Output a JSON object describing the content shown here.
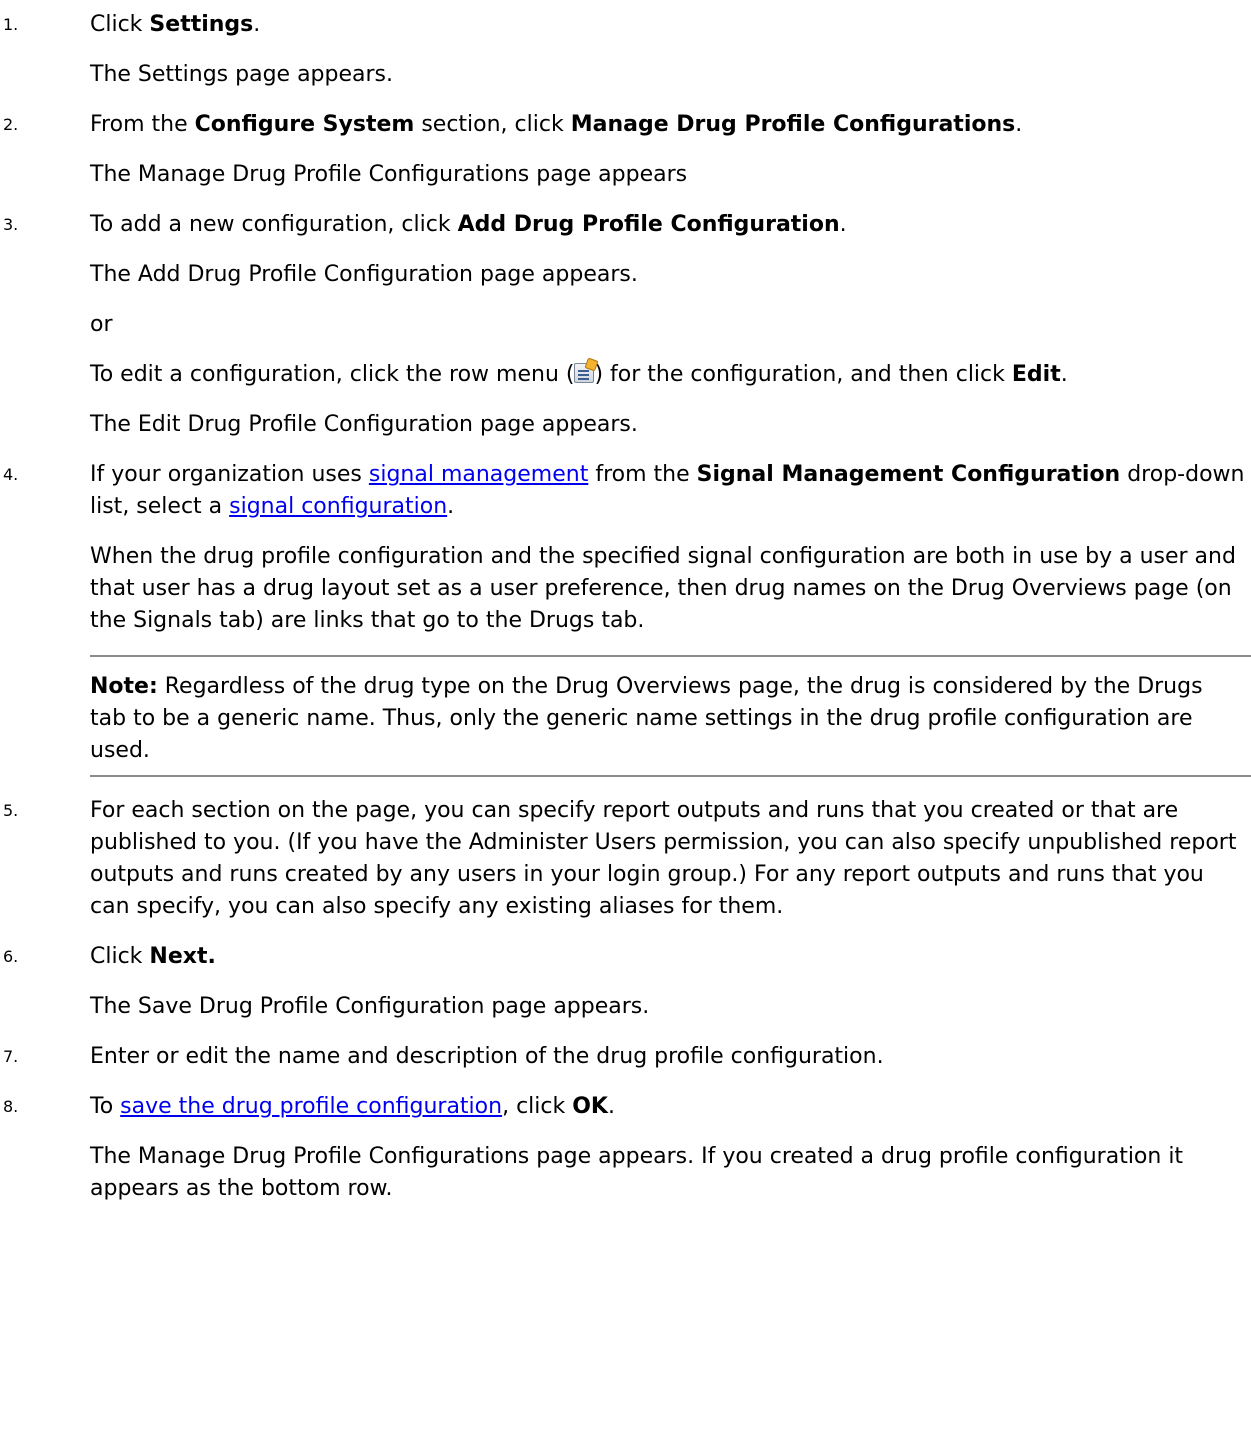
{
  "steps": [
    {
      "number": "1.",
      "main": {
        "pre": "Click ",
        "bold1": "Settings",
        "post": "."
      },
      "result": "The Settings page appears."
    },
    {
      "number": "2.",
      "main": {
        "pre": "From the ",
        "bold1": "Configure System",
        "mid": " section, click ",
        "bold2": "Manage Drug Profile Configurations",
        "post": "."
      },
      "result": "The Manage Drug Profile Configurations page appears"
    },
    {
      "number": "3.",
      "main": {
        "pre": "To add a new configuration, click ",
        "bold1": "Add Drug Profile Configuration",
        "post": "."
      },
      "result": "The Add Drug Profile Configuration page appears.",
      "or": "or",
      "alt": {
        "pre": "To edit a configuration, click the row menu (",
        "mid": ") for the configuration, and then click ",
        "bold": "Edit",
        "post": "."
      },
      "alt_icon": "row-menu-icon",
      "alt_result": "The Edit Drug Profile Configuration page appears."
    },
    {
      "number": "4.",
      "main": {
        "pre": "If your organization uses ",
        "link1": "signal management",
        "mid1": " from the ",
        "bold1": "Signal Management Configuration",
        "mid2": " drop-down list, select a ",
        "link2": "signal configuration",
        "post": "."
      },
      "result": "When the drug profile configuration and the specified signal configuration are both in use by a user and that user has a drug layout set as a user preference, then drug names on the Drug Overviews page (on the Signals tab) are links that go to the Drugs tab.",
      "note": {
        "label": "Note:",
        "text": " Regardless of the drug type on the Drug Overviews page, the drug is considered by the Drugs tab to be a generic name. Thus, only the generic name settings in the drug profile configuration are used."
      }
    },
    {
      "number": "5.",
      "main": {
        "text": "For each section on the page, you can specify report outputs and runs that you created or that are published to you. (If you have the Administer Users permission, you can also specify unpublished report outputs and runs created by any users in your login group.) For any report outputs and runs that you can specify, you can also specify any existing aliases for them."
      }
    },
    {
      "number": "6.",
      "main": {
        "pre": "Click ",
        "bold1": "Next."
      },
      "result": "The Save Drug Profile Configuration page appears."
    },
    {
      "number": "7.",
      "main": {
        "text": "Enter or edit the name and description of the drug profile configuration."
      }
    },
    {
      "number": "8.",
      "main": {
        "pre": "To ",
        "link1": "save the drug profile configuration",
        "mid": ", click ",
        "bold1": "OK",
        "post": "."
      },
      "result": "The Manage Drug Profile Configurations page appears. If you created a drug profile configuration it appears as the bottom row."
    }
  ],
  "colors": {
    "link": "#0000ee",
    "rule": "#8c8c8c",
    "text": "#000000"
  }
}
